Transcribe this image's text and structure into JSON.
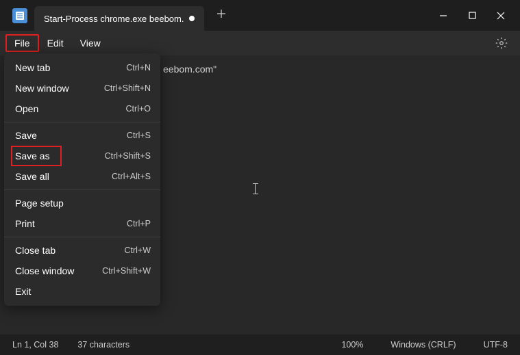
{
  "titlebar": {
    "tab_title": "Start-Process chrome.exe beebom."
  },
  "menubar": {
    "file": "File",
    "edit": "Edit",
    "view": "View"
  },
  "dropdown": {
    "items": [
      {
        "label": "New tab",
        "shortcut": "Ctrl+N"
      },
      {
        "label": "New window",
        "shortcut": "Ctrl+Shift+N"
      },
      {
        "label": "Open",
        "shortcut": "Ctrl+O"
      },
      {
        "label": "Save",
        "shortcut": "Ctrl+S"
      },
      {
        "label": "Save as",
        "shortcut": "Ctrl+Shift+S"
      },
      {
        "label": "Save all",
        "shortcut": "Ctrl+Alt+S"
      },
      {
        "label": "Page setup",
        "shortcut": ""
      },
      {
        "label": "Print",
        "shortcut": "Ctrl+P"
      },
      {
        "label": "Close tab",
        "shortcut": "Ctrl+W"
      },
      {
        "label": "Close window",
        "shortcut": "Ctrl+Shift+W"
      },
      {
        "label": "Exit",
        "shortcut": ""
      }
    ]
  },
  "editor": {
    "content_fragment": "eebom.com\""
  },
  "statusbar": {
    "position": "Ln 1, Col 38",
    "chars": "37 characters",
    "zoom": "100%",
    "eol": "Windows (CRLF)",
    "encoding": "UTF-8"
  }
}
